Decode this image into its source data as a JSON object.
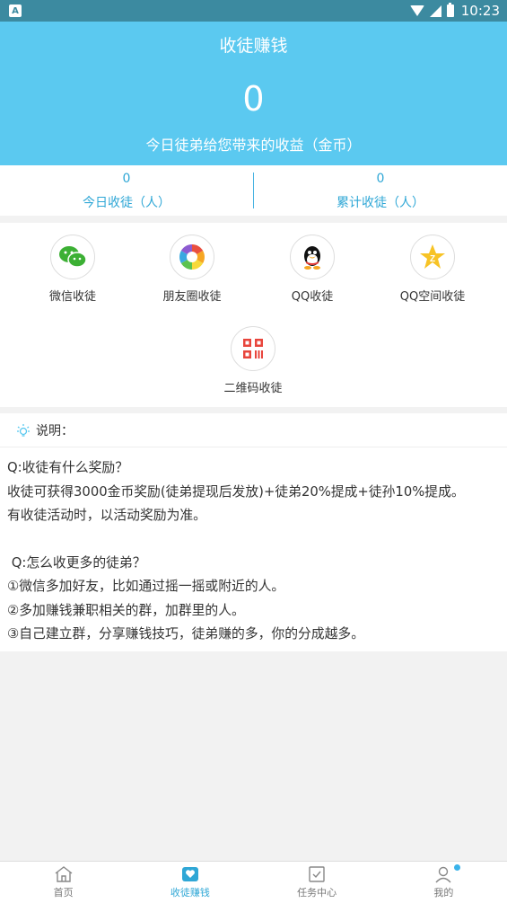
{
  "status_bar": {
    "time": "10:23",
    "app_badge": "A"
  },
  "header": {
    "title": "收徒赚钱",
    "today_amount": "0",
    "subtitle": "今日徒弟给您带来的收益（金币）"
  },
  "stats": [
    {
      "value": "0",
      "label": "今日收徒（人）"
    },
    {
      "value": "0",
      "label": "累计收徒（人）"
    }
  ],
  "share_options": [
    {
      "label": "微信收徒",
      "icon": "wechat-icon"
    },
    {
      "label": "朋友圈收徒",
      "icon": "moments-icon"
    },
    {
      "label": "QQ收徒",
      "icon": "qq-icon"
    },
    {
      "label": "QQ空间收徒",
      "icon": "qzone-icon"
    },
    {
      "label": "二维码收徒",
      "icon": "qrcode-icon"
    }
  ],
  "notes": {
    "heading": "说明：",
    "lines": [
      "Q:收徒有什么奖励？",
      "收徒可获得3000金币奖励(徒弟提现后发放)+徒弟20%提成+徒孙10%提成。",
      "有收徒活动时，以活动奖励为准。",
      " Q:怎么收更多的徒弟？",
      "①微信多加好友，比如通过摇一摇或附近的人。",
      "②多加赚钱兼职相关的群，加群里的人。",
      "③自己建立群，分享赚钱技巧，徒弟赚的多，你的分成越多。"
    ]
  },
  "tabs": [
    {
      "label": "首页",
      "icon": "home-icon"
    },
    {
      "label": "收徒赚钱",
      "icon": "heart-box-icon"
    },
    {
      "label": "任务中心",
      "icon": "task-icon"
    },
    {
      "label": "我的",
      "icon": "profile-icon"
    }
  ],
  "colors": {
    "header_bg": "#5bc9f0",
    "accent": "#2fa7d6",
    "status_bar": "#3c8aa0"
  }
}
